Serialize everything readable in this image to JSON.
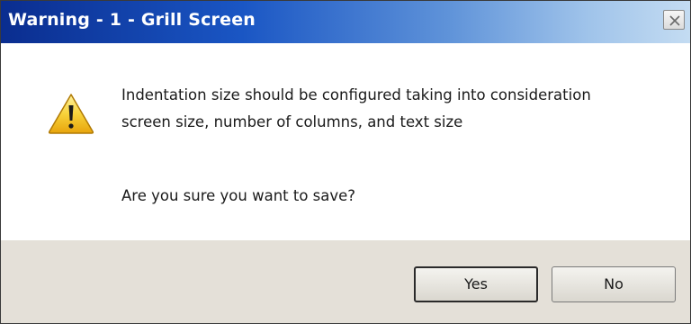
{
  "window": {
    "title": "Warning - 1 - Grill Screen",
    "close_icon": "close-icon"
  },
  "message": {
    "icon": "warning-icon",
    "icon_color": "#f5c518",
    "line1": "Indentation size should be configured taking into consideration",
    "line2": "screen size, number of columns, and text size",
    "question": "Are you sure you want to save?"
  },
  "buttons": {
    "yes_label": "Yes",
    "no_label": "No"
  },
  "colors": {
    "titlebar_start": "#0a2d8f",
    "titlebar_end": "#c4dcf2",
    "footer_bg": "#e4e0d8"
  }
}
